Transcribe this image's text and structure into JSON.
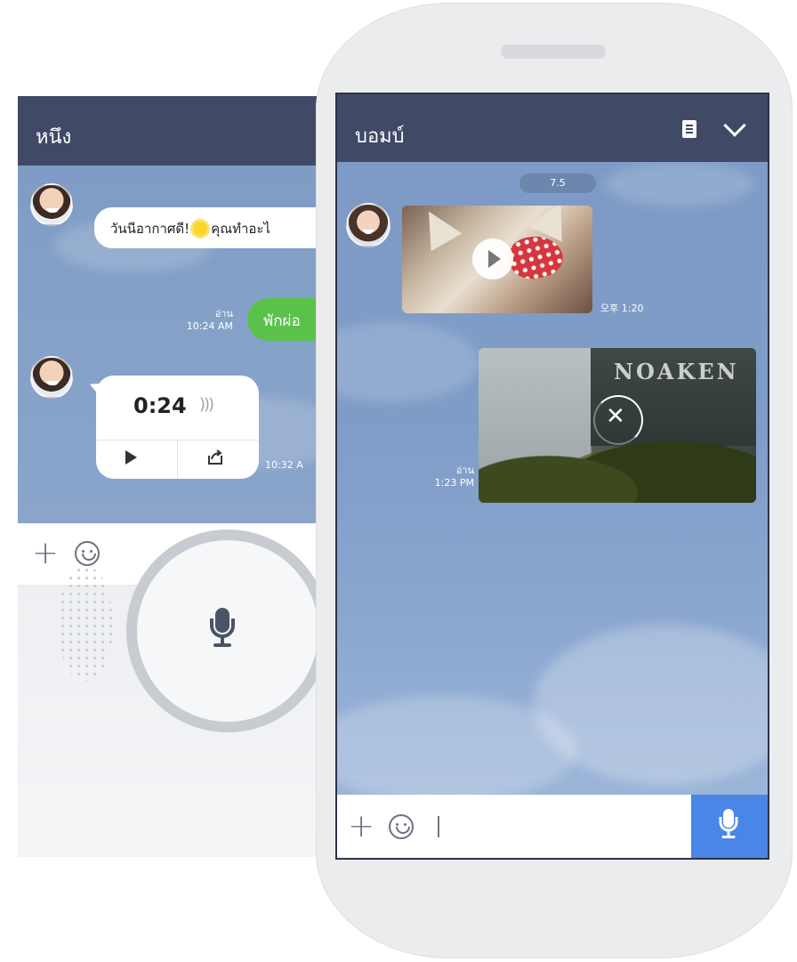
{
  "back_chat": {
    "title": "หนึง",
    "msg_weather_part1": "วันนีอากาศดี!",
    "msg_weather_part2": "คุณทำอะไ",
    "read_label": "อ่าน",
    "read_time": "10:24 AM",
    "msg_reply": "พักผ่อ",
    "voice_duration": "0:24",
    "voice_wave": ")))",
    "voice_time": "10:32 A"
  },
  "front_chat": {
    "title": "บอมบ์",
    "date_label": "7.5",
    "video1_time": "오후 1:20",
    "video2_sign": "NOAKEN",
    "read_label": "อ่าน",
    "read_time": "1:23 PM"
  },
  "colors": {
    "header": "#404a66",
    "chat_bg": "#7f9cc5",
    "green_bubble": "#5ac24b",
    "mic_button": "#4a86e8"
  },
  "icons": [
    "plus-icon",
    "smiley-icon",
    "microphone-icon",
    "play-icon",
    "share-icon",
    "note-icon",
    "chevron-down-icon",
    "close-icon"
  ]
}
